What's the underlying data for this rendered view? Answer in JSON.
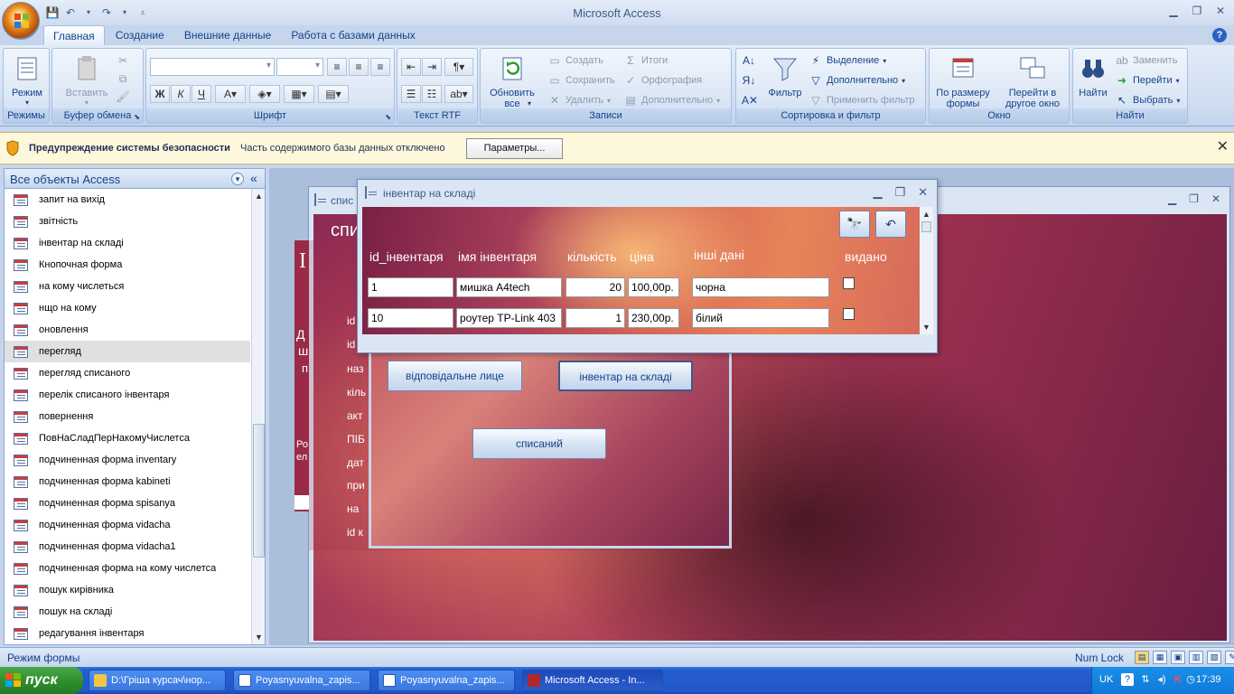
{
  "app": {
    "title": "Microsoft Access"
  },
  "tabs": [
    "Главная",
    "Создание",
    "Внешние данные",
    "Работа с базами данных"
  ],
  "ribbon": {
    "groups": {
      "views": "Режимы",
      "clipboard": "Буфер обмена",
      "font": "Шрифт",
      "rtf": "Текст RTF",
      "records": "Записи",
      "sort": "Сортировка и фильтр",
      "window": "Окно",
      "find": "Найти"
    },
    "view_btn": "Режим",
    "paste_btn": "Вставить",
    "refresh_btn": "Обновить все",
    "records": {
      "new": "Создать",
      "save": "Сохранить",
      "delete": "Удалить",
      "totals": "Итоги",
      "spelling": "Орфография",
      "more": "Дополнительно"
    },
    "filter_btn": "Фильтр",
    "sort": {
      "selection": "Выделение",
      "advanced": "Дополнительно",
      "toggle": "Применить фильтр"
    },
    "window": {
      "fit": "По размеру формы",
      "switch": "Перейти в другое окно"
    },
    "find": {
      "find": "Найти",
      "replace": "Заменить",
      "goto": "Перейти",
      "select": "Выбрать"
    }
  },
  "security": {
    "title": "Предупреждение системы безопасности",
    "message": "Часть содержимого базы данных отключено",
    "button": "Параметры..."
  },
  "nav": {
    "title": "Все объекты Access",
    "items": [
      "запит на вихід",
      "звітність",
      "інвентар на складі",
      "Кнопочная форма",
      "на кому числеться",
      "нщо на кому",
      "оновлення",
      "перегляд",
      "перегляд списаного",
      "перелік списаного інвентаря",
      "повернення",
      "ПовНаСладПерНакомуЧислетса",
      "подчиненная форма inventary",
      "подчиненная форма kabineti",
      "подчиненная форма spisanya",
      "подчиненная форма vidacha",
      "подчиненная форма vidacha1",
      "подчиненная форма на кому числетса",
      "пошук кирівника",
      "пошук на складі",
      "редагування інвентаря"
    ],
    "selected_index": 7
  },
  "bgform": {
    "title": "спис"
  },
  "midform": {
    "heading": "спи",
    "labels": [
      "id",
      "id",
      "наз",
      "кіль",
      "акт",
      "ПІБ",
      "дат",
      "при",
      "на",
      "id к"
    ],
    "side_letters": [
      "І",
      "Д",
      "ш",
      "п",
      "Ро",
      "ел"
    ],
    "buttons": {
      "responsible": "відповідальне лице",
      "inventory": "інвентар на складі",
      "written_off": "списаний"
    }
  },
  "fgform": {
    "title": "інвентар на складі",
    "headers": {
      "id": "id_інвентаря",
      "name": "імя інвентаря",
      "qty": "кількість",
      "price": "ціна",
      "other": "інші дані",
      "issued": "видано"
    },
    "rows": [
      {
        "id": "1",
        "name": "мишка A4tech",
        "qty": "20",
        "price": "100,00р.",
        "other": "чорна",
        "issued": false
      },
      {
        "id": "10",
        "name": "роутер TP-Link 403",
        "qty": "1",
        "price": "230,00р.",
        "other": "білий",
        "issued": false
      }
    ]
  },
  "status": {
    "mode": "Режим формы",
    "numlock": "Num Lock"
  },
  "taskbar": {
    "start": "пуск",
    "tasks": [
      "D:\\Гріша курсач\\нор...",
      "Poyasnyuvalna_zapis...",
      "Poyasnyuvalna_zapis...",
      "Microsoft Access - In..."
    ],
    "lang": "UK",
    "time": "17:39"
  }
}
